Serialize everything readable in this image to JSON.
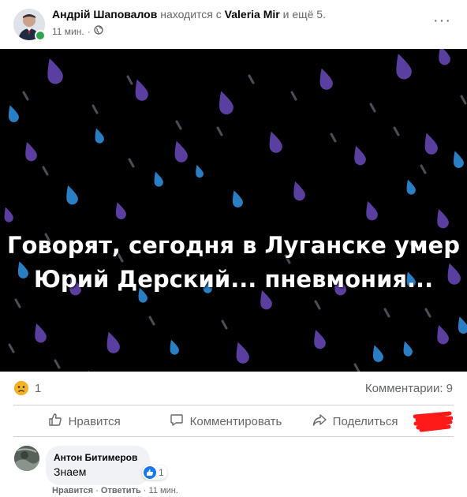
{
  "header": {
    "author": "Андрій Шаповалов",
    "with_text": " находится с ",
    "tagged": "Valeria Mir",
    "and_more": " и ещё 5",
    "period": ".",
    "time": "11 мин.",
    "dot": "·",
    "audience_icon": "globe-icon",
    "more": "···"
  },
  "image": {
    "line1": "Говорят, сегодня в Луганске умер",
    "line2": "Юрий Дерский... пневмония..."
  },
  "reactions": {
    "icon": "sad-face-icon",
    "count": "1",
    "comments": "Комментарии: 9"
  },
  "actions": {
    "like": "Нравится",
    "comment": "Комментировать",
    "share": "Поделиться"
  },
  "comment": {
    "author": "Антон Битимеров",
    "text": "Знаем",
    "like_count": "1",
    "like_action": "Нравится",
    "separator": "·",
    "reply_action": "Ответить",
    "time": "11 мин."
  },
  "colors": {
    "accent": "#1877f2",
    "drop_purple": "#5b3fa0",
    "drop_blue": "#2a7fc4",
    "online": "#31a24c"
  }
}
